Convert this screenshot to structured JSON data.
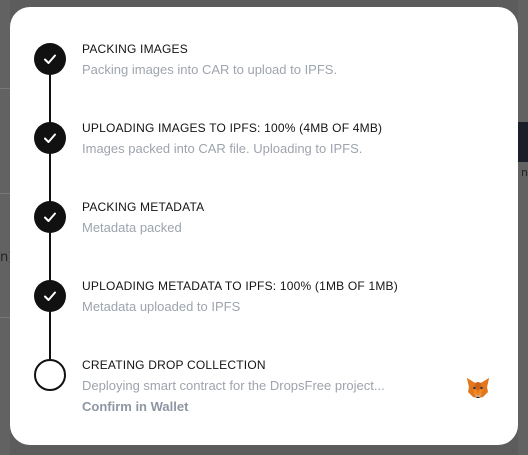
{
  "background": {
    "left_text": "n)",
    "right_text": "n"
  },
  "steps": [
    {
      "title": "PACKING IMAGES",
      "subtitle": "Packing images into CAR to upload to IPFS.",
      "status": "done"
    },
    {
      "title": "UPLOADING IMAGES TO IPFS: 100% (4MB OF 4MB)",
      "subtitle": "Images packed into CAR file. Uploading to IPFS.",
      "status": "done"
    },
    {
      "title": "PACKING METADATA",
      "subtitle": "Metadata packed",
      "status": "done"
    },
    {
      "title": "UPLOADING METADATA TO IPFS: 100% (1MB OF 1MB)",
      "subtitle": "Metadata uploaded to IPFS",
      "status": "done"
    },
    {
      "title": "CREATING DROP COLLECTION",
      "subtitle": "Deploying smart contract for the DropsFree project...",
      "status": "pending",
      "action_label": "Confirm in Wallet",
      "wallet_icon": "metamask-fox-icon"
    }
  ],
  "colors": {
    "done": "#111111",
    "title": "#141414",
    "subtitle": "#9ea4ad",
    "action": "#8d96a3",
    "overlay": "#5c5c5c"
  }
}
